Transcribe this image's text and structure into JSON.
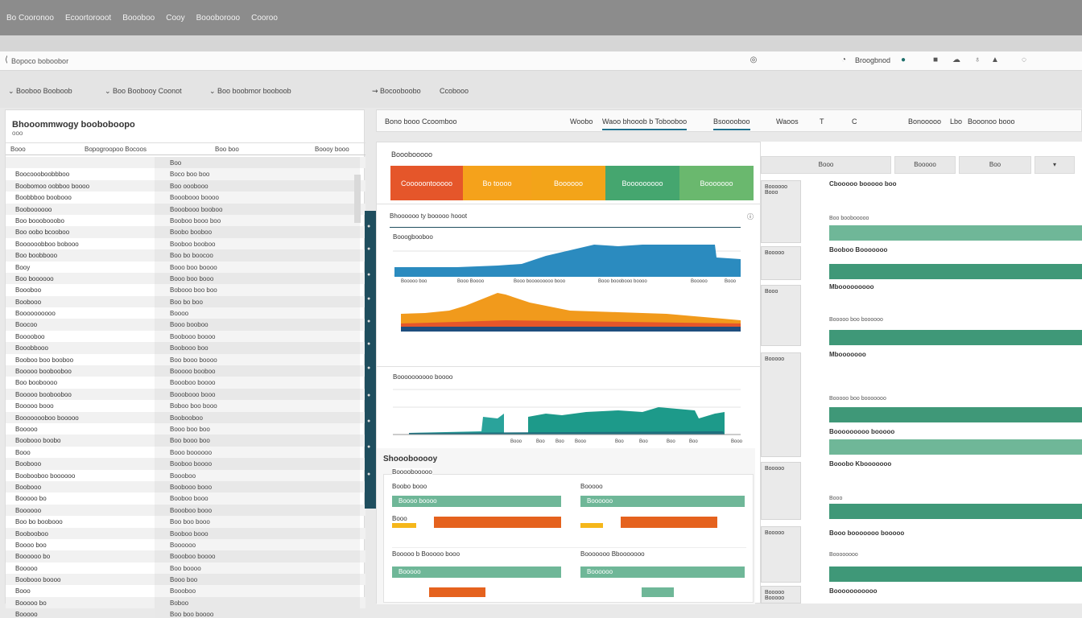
{
  "menu": [
    "Bo Cooronoo",
    "Ecoortorooot",
    "Boooboo",
    "Cooy",
    "Boooborooo",
    "Cooroo"
  ],
  "address": {
    "path": "Bopoco boboobor",
    "user_label": "Broogbnod"
  },
  "toolbar": [
    "Booboo Booboob",
    "Boo Boobooy Coonot",
    "Boo boobmor booboob",
    "Bocooboobo",
    "Ccobooo"
  ],
  "left_panel": {
    "title": "Bhooommwogy booboboopo",
    "subtitle": "ooo",
    "headers": [
      "Booo",
      "Bopogroopoo Bocoos",
      "Boo boo",
      "Boooy booo"
    ],
    "rows": [
      {
        "name": "",
        "value": "Boo"
      },
      {
        "name": "Boocoooboobbboo",
        "value": "Boco boo boo"
      },
      {
        "name": "Boobomoo oobboo boooo",
        "value": "Boo ooobooo"
      },
      {
        "name": "Boobbboo boobooo",
        "value": "Booobooo boooo"
      },
      {
        "name": "Booboooooo",
        "value": "Booobooo booboo"
      },
      {
        "name": "Boo booobooobo",
        "value": "Booboo booo boo"
      },
      {
        "name": "Boo oobo bcooboo",
        "value": "Boobo booboo"
      },
      {
        "name": "Boooooobboo bobooo",
        "value": "Booboo booboo"
      },
      {
        "name": "Boo boobbooo",
        "value": "Boo bo boocoo"
      },
      {
        "name": "Booy",
        "value": "Booo boo boooo"
      },
      {
        "name": "Boo boooooo",
        "value": "Booo boo booo"
      },
      {
        "name": "Boooboo",
        "value": "Bobooo boo boo"
      },
      {
        "name": "Boobooo",
        "value": "Boo bo boo"
      },
      {
        "name": "Boooooooooo",
        "value": "Boooo"
      },
      {
        "name": "Boocoo",
        "value": "Booo booboo"
      },
      {
        "name": "Booooboo",
        "value": "Boobooo boooo"
      },
      {
        "name": "Booobbooo",
        "value": "Boobooo boo"
      },
      {
        "name": "Booboo boo booboo",
        "value": "Boo booo boooo"
      },
      {
        "name": "Booooo boobooboo",
        "value": "Booooo booboo"
      },
      {
        "name": "Boo booboooo",
        "value": "Boooboo boooo"
      },
      {
        "name": "Booooo boobooboo",
        "value": "Booobooo booo"
      },
      {
        "name": "Booooo booo",
        "value": "Boboo boo booo"
      },
      {
        "name": "Boooooooboo booooo",
        "value": "Boobooboo"
      },
      {
        "name": "Booooo",
        "value": "Booo boo boo"
      },
      {
        "name": "Boobooo boobo",
        "value": "Boo booo boo"
      },
      {
        "name": "Booo",
        "value": "Booo boooooo"
      },
      {
        "name": "Boobooo",
        "value": "Booboo boooo"
      },
      {
        "name": "Boobooboo boooooo",
        "value": "Boooboo"
      },
      {
        "name": "Boobooo",
        "value": "Boobooo booo"
      },
      {
        "name": "Booooo bo",
        "value": "Booboo booo"
      },
      {
        "name": "Boooooo",
        "value": "Boooboo booo"
      },
      {
        "name": "Boo bo boobooo",
        "value": "Boo boo booo"
      },
      {
        "name": "Boobooboo",
        "value": "Booboo booo"
      },
      {
        "name": "Boooo boo",
        "value": "Boooooo"
      },
      {
        "name": "Boooooo bo",
        "value": "Boooboo boooo"
      },
      {
        "name": "Booooo",
        "value": "Boo boooo"
      },
      {
        "name": "Boobooo boooo",
        "value": "Booo boo"
      },
      {
        "name": "Booo",
        "value": "Boooboo"
      },
      {
        "name": "Booooo bo",
        "value": "Boboo"
      },
      {
        "name": "Booooo",
        "value": "Boo boo boooo"
      }
    ]
  },
  "tabs": [
    "Bono booo Ccoomboo",
    "Woobo",
    "Waoo bhooob b Tobooboo",
    "Bsooooboo",
    "Waoos",
    "Bonooooo",
    "Lbo",
    "Booonoo booo"
  ],
  "kpi_section": {
    "title": "Booobooooo",
    "cards": [
      {
        "label": "Cooooontooooo",
        "color": "#e5562a"
      },
      {
        "label": "Bo toooo",
        "color": "#f5a21b"
      },
      {
        "label": "Boooooo",
        "color": "#f3a419"
      },
      {
        "label": "Booooooooo",
        "color": "#45a66f"
      },
      {
        "label": "Booooooo",
        "color": "#6ab86e"
      }
    ]
  },
  "chart1": {
    "title": "Bhoooooo ty booooo hooot",
    "subtitle": "Booogbooboo",
    "axis_labels": [
      "Booooo boo",
      "Booo Boooo",
      "Booo booooooooo booo",
      "Booo booobooo boooo",
      "Booooo",
      "Booo"
    ]
  },
  "chart2": {
    "title": "Boooooooooo boooo",
    "axis_labels": [
      "Booo",
      "Boo",
      "Boo",
      "Booo",
      "Boo",
      "Boo",
      "Boo",
      "Boo",
      "Booo"
    ]
  },
  "sub_panel": {
    "title": "Shooobooooy",
    "subtitle": "Boooobooooo",
    "bars": [
      {
        "label": "Boobo booo",
        "text": "Boooo boooo",
        "color": "#6fb798"
      },
      {
        "label": "Booooo",
        "text": "Boooooo",
        "color": "#6fb798"
      },
      {
        "label": "Booooo b Booooo booo",
        "text": "Booooo",
        "color": "#6fb798"
      },
      {
        "label": "Booooooo Bbooooooo",
        "text": "Boooooo",
        "color": "#6fb798"
      }
    ],
    "secondary_label": "Booo"
  },
  "right_panel": {
    "headers": [
      "Booo",
      "Booooo",
      "Boo"
    ],
    "cells": [
      "Boooooo Booo",
      "Booooo",
      "Booo",
      "Booooo",
      "Booooo",
      "Booooo",
      "Booooo Booooo"
    ],
    "groups": [
      {
        "title": "Cbooooo booooo boo",
        "line": "Boo boobooooo"
      },
      {
        "title": "Booboo Booooooo",
        "line": ""
      },
      {
        "title": "Mbooooooooo",
        "line": "Booooo boo boooooo"
      },
      {
        "title": "Mbooooooo",
        "line": "Booooo boo booooooo"
      },
      {
        "title": "Booooooooo booooo",
        "line": ""
      },
      {
        "title": "Booobo Kbooooooo",
        "line": "Booo"
      },
      {
        "title": "Booo booooooo booooo",
        "line": "Boooooooo"
      },
      {
        "title": "Booooooooooo",
        "line": ""
      }
    ]
  }
}
